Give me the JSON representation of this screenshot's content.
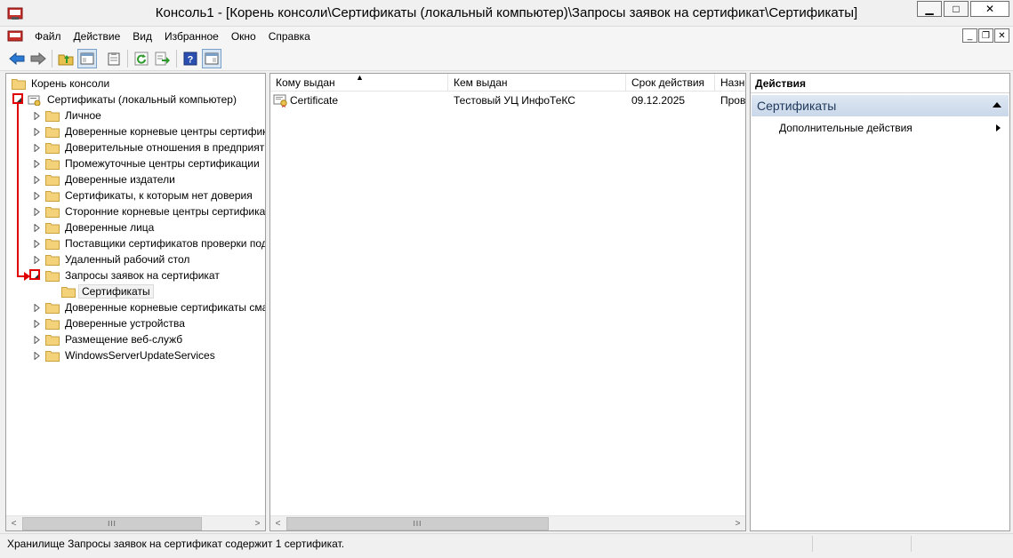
{
  "window": {
    "title": "Консоль1 - [Корень консоли\\Сертификаты (локальный компьютер)\\Запросы заявок на сертификат\\Сертификаты]",
    "minimize": "▁",
    "maximize": "□",
    "close": "✕"
  },
  "menu": {
    "items": [
      "Файл",
      "Действие",
      "Вид",
      "Избранное",
      "Окно",
      "Справка"
    ],
    "mdi_minimize": "_",
    "mdi_restore": "❐",
    "mdi_close": "✕"
  },
  "toolbar": {
    "icons": [
      "back-arrow-icon",
      "forward-arrow-icon",
      "up-folder-icon",
      "show-hide-tree-icon",
      "clipboard-icon",
      "refresh-icon",
      "export-list-icon",
      "help-icon",
      "show-hide-action-pane-icon"
    ]
  },
  "tree": {
    "root": "Корень консоли",
    "store": "Сертификаты (локальный компьютер)",
    "items": [
      "Личное",
      "Доверенные корневые центры сертифик",
      "Доверительные отношения в предприяти",
      "Промежуточные центры сертификации",
      "Доверенные издатели",
      "Сертификаты, к которым нет доверия",
      "Сторонние корневые центры сертифика",
      "Доверенные лица",
      "Поставщики сертификатов проверки под",
      "Удаленный рабочий стол",
      "Запросы заявок на сертификат"
    ],
    "child": "Сертификаты",
    "items_after": [
      "Доверенные корневые сертификаты сма",
      "Доверенные устройства",
      "Размещение веб-служб",
      "WindowsServerUpdateServices"
    ]
  },
  "list": {
    "columns": [
      "Кому выдан",
      "Кем выдан",
      "Срок действия",
      "Назн"
    ],
    "rows": [
      [
        "Certificate",
        "Тестовый УЦ ИнфоТеКС",
        "09.12.2025",
        "Пров"
      ]
    ]
  },
  "actions": {
    "header": "Действия",
    "section": "Сертификаты",
    "item": "Дополнительные действия"
  },
  "scrollbar": {
    "left": "<",
    "right": ">",
    "thumb": "III"
  },
  "status": {
    "text": "Хранилище Запросы заявок на сертификат содержит 1 сертификат."
  },
  "colors": {
    "annotation": "#e00000",
    "action_section": "#c9d7e9"
  }
}
